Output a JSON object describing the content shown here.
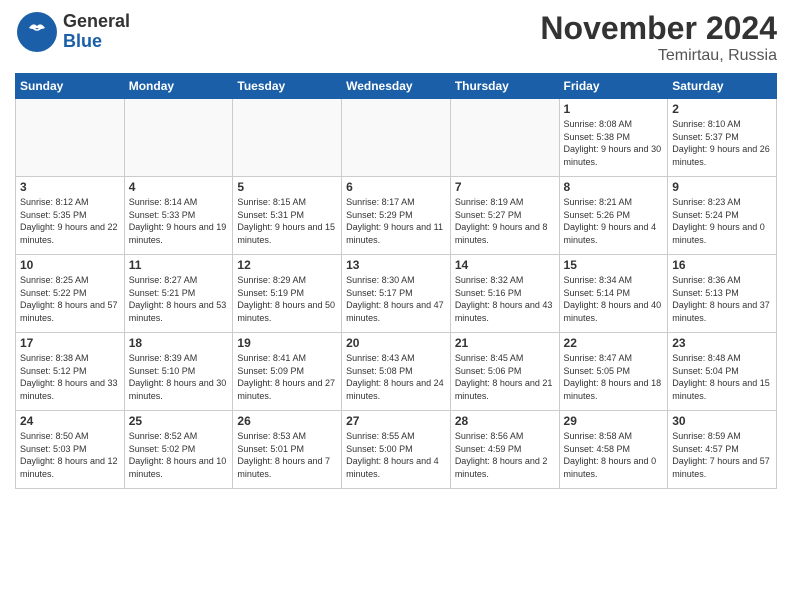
{
  "header": {
    "logo_general": "General",
    "logo_blue": "Blue",
    "month": "November 2024",
    "location": "Temirtau, Russia"
  },
  "weekdays": [
    "Sunday",
    "Monday",
    "Tuesday",
    "Wednesday",
    "Thursday",
    "Friday",
    "Saturday"
  ],
  "weeks": [
    [
      {
        "day": "",
        "info": ""
      },
      {
        "day": "",
        "info": ""
      },
      {
        "day": "",
        "info": ""
      },
      {
        "day": "",
        "info": ""
      },
      {
        "day": "",
        "info": ""
      },
      {
        "day": "1",
        "info": "Sunrise: 8:08 AM\nSunset: 5:38 PM\nDaylight: 9 hours and 30 minutes."
      },
      {
        "day": "2",
        "info": "Sunrise: 8:10 AM\nSunset: 5:37 PM\nDaylight: 9 hours and 26 minutes."
      }
    ],
    [
      {
        "day": "3",
        "info": "Sunrise: 8:12 AM\nSunset: 5:35 PM\nDaylight: 9 hours and 22 minutes."
      },
      {
        "day": "4",
        "info": "Sunrise: 8:14 AM\nSunset: 5:33 PM\nDaylight: 9 hours and 19 minutes."
      },
      {
        "day": "5",
        "info": "Sunrise: 8:15 AM\nSunset: 5:31 PM\nDaylight: 9 hours and 15 minutes."
      },
      {
        "day": "6",
        "info": "Sunrise: 8:17 AM\nSunset: 5:29 PM\nDaylight: 9 hours and 11 minutes."
      },
      {
        "day": "7",
        "info": "Sunrise: 8:19 AM\nSunset: 5:27 PM\nDaylight: 9 hours and 8 minutes."
      },
      {
        "day": "8",
        "info": "Sunrise: 8:21 AM\nSunset: 5:26 PM\nDaylight: 9 hours and 4 minutes."
      },
      {
        "day": "9",
        "info": "Sunrise: 8:23 AM\nSunset: 5:24 PM\nDaylight: 9 hours and 0 minutes."
      }
    ],
    [
      {
        "day": "10",
        "info": "Sunrise: 8:25 AM\nSunset: 5:22 PM\nDaylight: 8 hours and 57 minutes."
      },
      {
        "day": "11",
        "info": "Sunrise: 8:27 AM\nSunset: 5:21 PM\nDaylight: 8 hours and 53 minutes."
      },
      {
        "day": "12",
        "info": "Sunrise: 8:29 AM\nSunset: 5:19 PM\nDaylight: 8 hours and 50 minutes."
      },
      {
        "day": "13",
        "info": "Sunrise: 8:30 AM\nSunset: 5:17 PM\nDaylight: 8 hours and 47 minutes."
      },
      {
        "day": "14",
        "info": "Sunrise: 8:32 AM\nSunset: 5:16 PM\nDaylight: 8 hours and 43 minutes."
      },
      {
        "day": "15",
        "info": "Sunrise: 8:34 AM\nSunset: 5:14 PM\nDaylight: 8 hours and 40 minutes."
      },
      {
        "day": "16",
        "info": "Sunrise: 8:36 AM\nSunset: 5:13 PM\nDaylight: 8 hours and 37 minutes."
      }
    ],
    [
      {
        "day": "17",
        "info": "Sunrise: 8:38 AM\nSunset: 5:12 PM\nDaylight: 8 hours and 33 minutes."
      },
      {
        "day": "18",
        "info": "Sunrise: 8:39 AM\nSunset: 5:10 PM\nDaylight: 8 hours and 30 minutes."
      },
      {
        "day": "19",
        "info": "Sunrise: 8:41 AM\nSunset: 5:09 PM\nDaylight: 8 hours and 27 minutes."
      },
      {
        "day": "20",
        "info": "Sunrise: 8:43 AM\nSunset: 5:08 PM\nDaylight: 8 hours and 24 minutes."
      },
      {
        "day": "21",
        "info": "Sunrise: 8:45 AM\nSunset: 5:06 PM\nDaylight: 8 hours and 21 minutes."
      },
      {
        "day": "22",
        "info": "Sunrise: 8:47 AM\nSunset: 5:05 PM\nDaylight: 8 hours and 18 minutes."
      },
      {
        "day": "23",
        "info": "Sunrise: 8:48 AM\nSunset: 5:04 PM\nDaylight: 8 hours and 15 minutes."
      }
    ],
    [
      {
        "day": "24",
        "info": "Sunrise: 8:50 AM\nSunset: 5:03 PM\nDaylight: 8 hours and 12 minutes."
      },
      {
        "day": "25",
        "info": "Sunrise: 8:52 AM\nSunset: 5:02 PM\nDaylight: 8 hours and 10 minutes."
      },
      {
        "day": "26",
        "info": "Sunrise: 8:53 AM\nSunset: 5:01 PM\nDaylight: 8 hours and 7 minutes."
      },
      {
        "day": "27",
        "info": "Sunrise: 8:55 AM\nSunset: 5:00 PM\nDaylight: 8 hours and 4 minutes."
      },
      {
        "day": "28",
        "info": "Sunrise: 8:56 AM\nSunset: 4:59 PM\nDaylight: 8 hours and 2 minutes."
      },
      {
        "day": "29",
        "info": "Sunrise: 8:58 AM\nSunset: 4:58 PM\nDaylight: 8 hours and 0 minutes."
      },
      {
        "day": "30",
        "info": "Sunrise: 8:59 AM\nSunset: 4:57 PM\nDaylight: 7 hours and 57 minutes."
      }
    ]
  ]
}
